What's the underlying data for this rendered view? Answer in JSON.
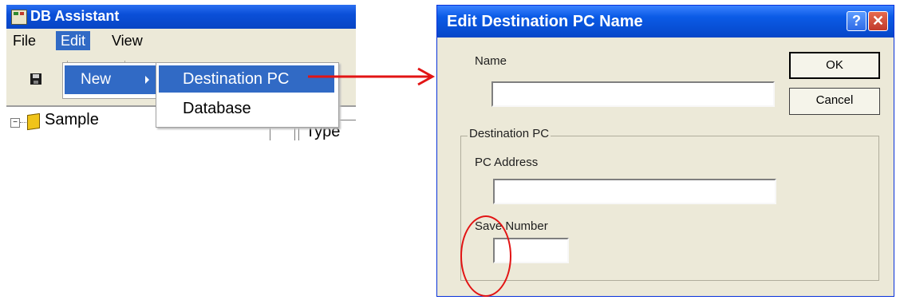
{
  "left_window": {
    "title": "DB Assistant",
    "menu": {
      "file": "File",
      "edit": "Edit",
      "view": "View"
    },
    "edit_menu": {
      "new_label": "New"
    },
    "new_submenu": {
      "destination_pc": "Destination PC",
      "database": "Database"
    },
    "tree": {
      "root_label": "Sample"
    },
    "list": {
      "type_header": "Type"
    }
  },
  "dialog": {
    "title": "Edit Destination PC Name",
    "help_glyph": "?",
    "close_glyph": "✕",
    "name_label": "Name",
    "name_value": "",
    "ok_label": "OK",
    "cancel_label": "Cancel",
    "group_label": "Destination PC",
    "pc_address_label": "PC Address",
    "pc_address_value": "",
    "save_number_label": "Save Number",
    "save_number_value": ""
  },
  "annotations": {
    "arrow_color": "#e21414",
    "circle_color": "#e21414"
  }
}
